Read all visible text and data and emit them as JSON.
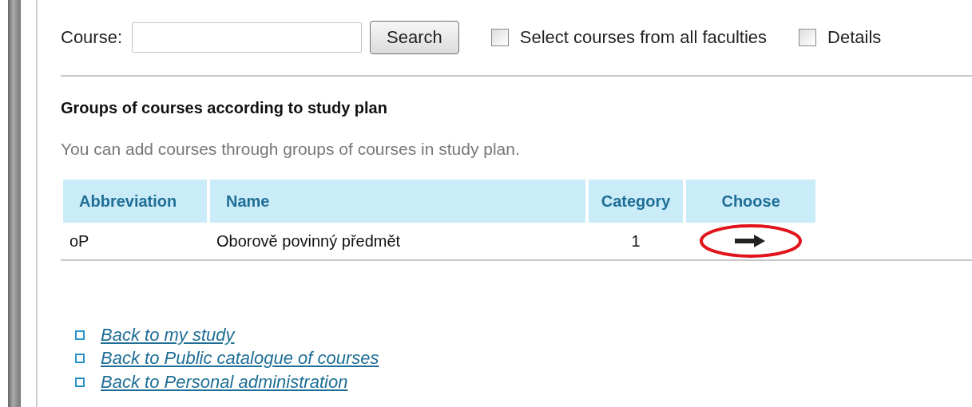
{
  "search": {
    "label": "Course:",
    "button": "Search",
    "options": [
      {
        "label": "Select courses from all faculties",
        "checked": false
      },
      {
        "label": "Details",
        "checked": false
      }
    ]
  },
  "groups": {
    "title": "Groups of courses according to study plan",
    "hint": "You can add courses through groups of courses in study plan.",
    "table": {
      "columns": [
        "Abbreviation",
        "Name",
        "Category",
        "Choose"
      ],
      "rows": [
        {
          "abbreviation": "oP",
          "name": "Oborově povinný předmět",
          "category": "1",
          "highlighted": true
        }
      ]
    }
  },
  "links": [
    "Back to my study",
    "Back to Public catalogue of courses",
    "Back to Personal administration"
  ]
}
